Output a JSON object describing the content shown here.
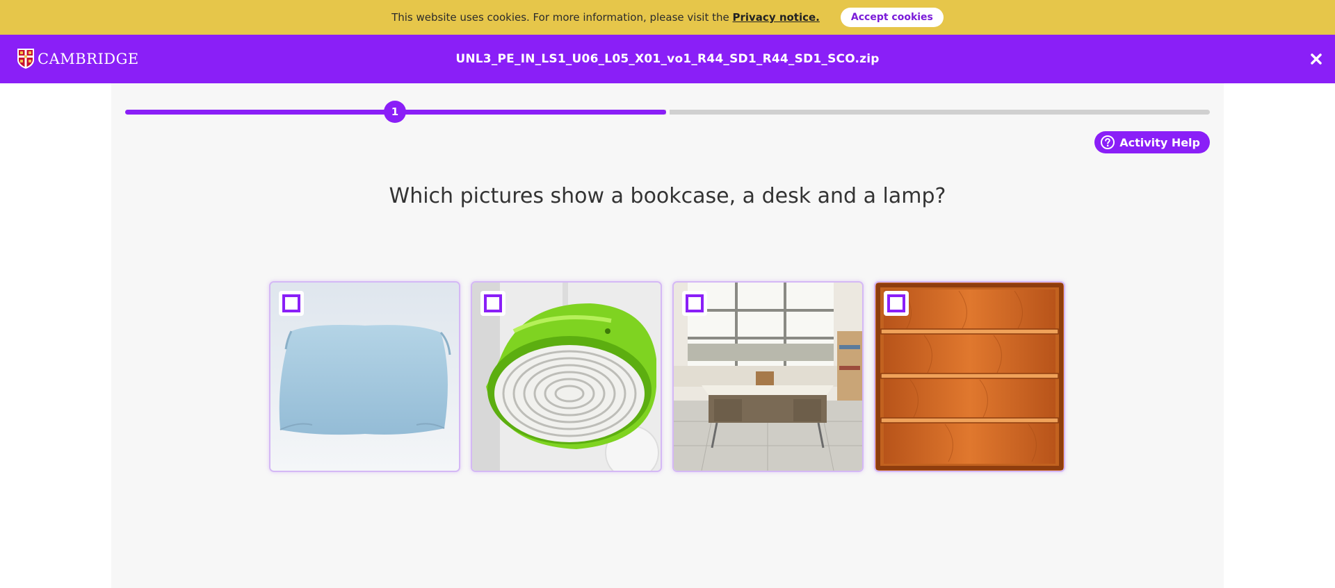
{
  "cookie_banner": {
    "text": "This website uses cookies. For more information, please visit the",
    "link_label": "Privacy notice.",
    "accept_label": "Accept cookies"
  },
  "header": {
    "logo_text": "CAMBRIDGE",
    "file_title": "UNL3_PE_IN_LS1_U06_L05_X01_vo1_R44_SD1_R44_SD1_SCO.zip",
    "close_icon": "close-icon"
  },
  "progress": {
    "current_step": "1",
    "fraction_complete": 0.5
  },
  "help": {
    "label": "Activity Help",
    "icon": "question-circle-icon"
  },
  "question": "Which pictures show a bookcase, a desk and a lamp?",
  "options": [
    {
      "id": "pillow",
      "checked": false
    },
    {
      "id": "lamp",
      "checked": false
    },
    {
      "id": "desk",
      "checked": false
    },
    {
      "id": "bookcase",
      "checked": false
    }
  ],
  "colors": {
    "accent": "#8a1ff7",
    "cookie_bar": "#e6c64a",
    "panel": "#f7f7f7"
  }
}
